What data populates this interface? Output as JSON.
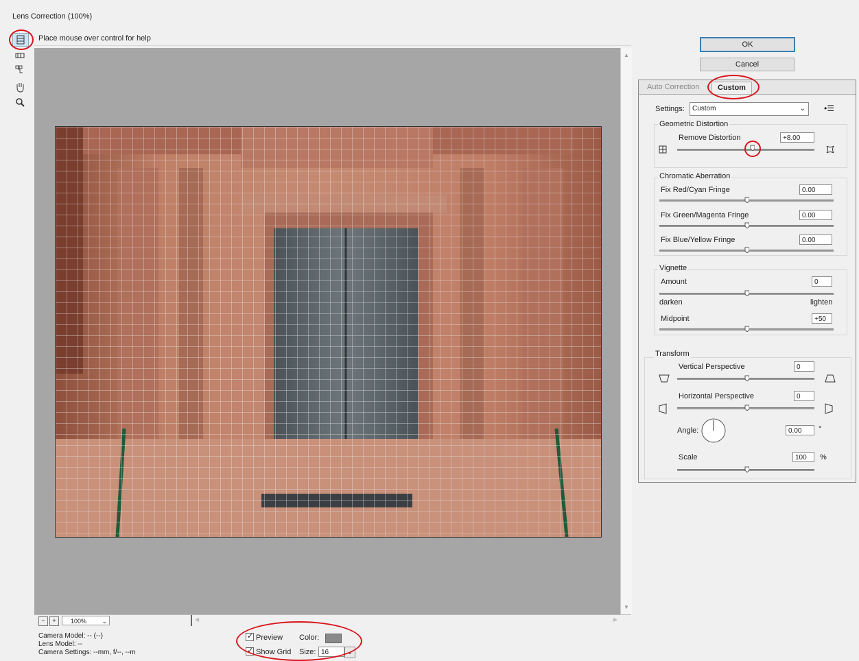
{
  "window": {
    "title": "Lens Correction (100%)"
  },
  "help_text": "Place mouse over control for help",
  "tools": [
    "remove-distortion-tool",
    "straighten-tool",
    "move-grid-tool",
    "hand-tool",
    "zoom-tool"
  ],
  "zoom": {
    "value": "100%"
  },
  "buttons": {
    "ok": "OK",
    "cancel": "Cancel"
  },
  "tabs": {
    "auto": "Auto Correction",
    "custom": "Custom"
  },
  "settings": {
    "label": "Settings:",
    "value": "Custom"
  },
  "geometric": {
    "title": "Geometric Distortion",
    "remove_label": "Remove Distortion",
    "remove_value": "+8.00"
  },
  "chromatic": {
    "title": "Chromatic Aberration",
    "red_label": "Fix Red/Cyan Fringe",
    "red_value": "0.00",
    "green_label": "Fix Green/Magenta Fringe",
    "green_value": "0.00",
    "blue_label": "Fix Blue/Yellow Fringe",
    "blue_value": "0.00"
  },
  "vignette": {
    "title": "Vignette",
    "amount_label": "Amount",
    "amount_value": "0",
    "darken": "darken",
    "lighten": "lighten",
    "midpoint_label": "Midpoint",
    "midpoint_value": "+50"
  },
  "transform": {
    "title": "Transform",
    "vert_label": "Vertical Perspective",
    "vert_value": "0",
    "horiz_label": "Horizontal Perspective",
    "horiz_value": "0",
    "angle_label": "Angle:",
    "angle_value": "0.00",
    "angle_unit": "°",
    "scale_label": "Scale",
    "scale_value": "100",
    "scale_unit": "%"
  },
  "info": {
    "camera_model": "Camera Model: -- (--)",
    "lens_model": "Lens Model: --",
    "camera_settings": "Camera Settings: --mm, f/--, --m"
  },
  "bottom": {
    "preview": "Preview",
    "show_grid": "Show Grid",
    "color_label": "Color:",
    "grid_color": "#8a8a8a",
    "size_label": "Size:",
    "size_value": "16"
  },
  "colors": {
    "highlight": "#d9141b",
    "canvas": "#a6a6a6",
    "ok_border": "#3c7fb1"
  }
}
